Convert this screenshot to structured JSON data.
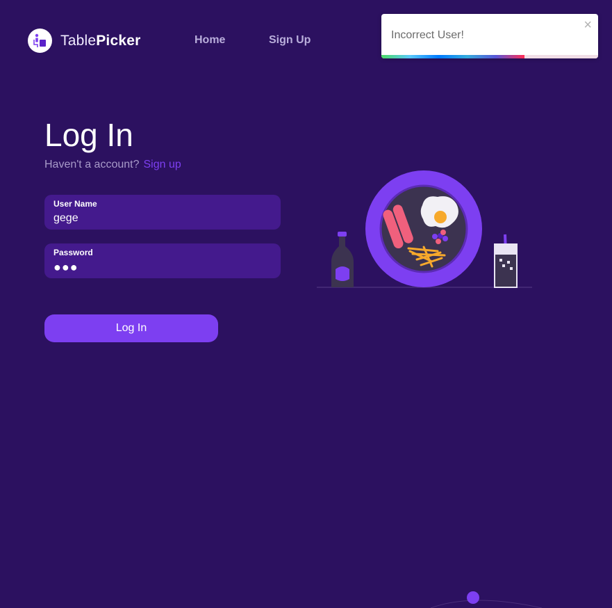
{
  "brand": {
    "name_light": "Table",
    "name_bold": "Picker",
    "icon": "table-person-icon"
  },
  "nav": {
    "home": "Home",
    "signup": "Sign Up"
  },
  "toast": {
    "message": "Incorrect User!",
    "close": "×",
    "progress": 0.66
  },
  "login": {
    "title": "Log In",
    "prompt": "Haven't a account?",
    "signup_link": "Sign up",
    "username": {
      "label": "User Name",
      "value": "gege"
    },
    "password": {
      "label": "Password",
      "value": "●●●"
    },
    "submit": "Log In"
  },
  "colors": {
    "background": "#2c1160",
    "accent": "#7d3ff1",
    "field": "#441a8d"
  }
}
